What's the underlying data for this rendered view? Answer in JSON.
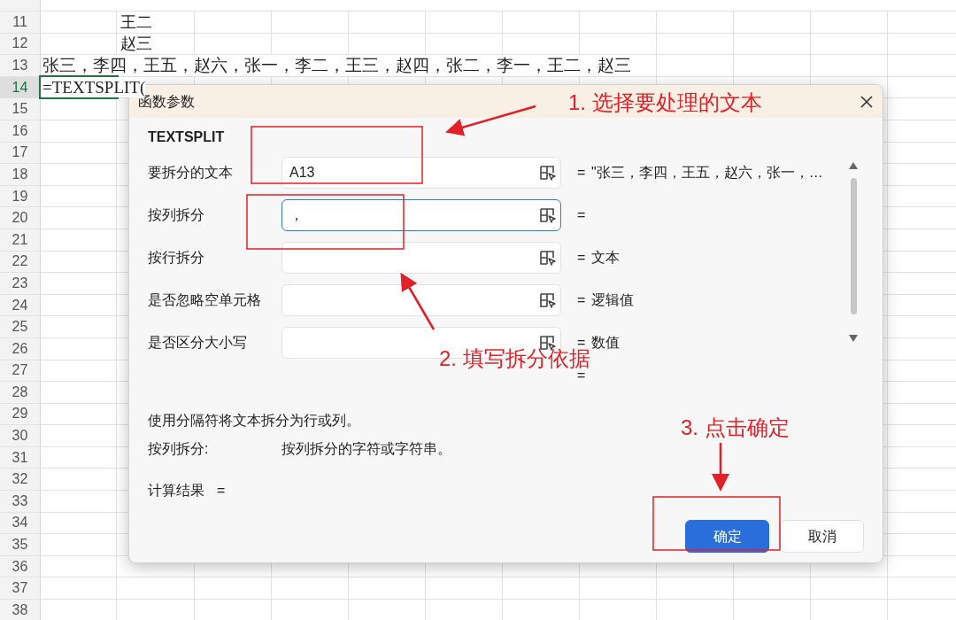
{
  "sheet": {
    "rows": [
      {
        "header": "11",
        "column_b": "王二",
        "selected": false
      },
      {
        "header": "12",
        "column_b": "赵三",
        "selected": false
      },
      {
        "header": "13",
        "column_a": "张三，李四，王五，赵六，张一，李二，王三，赵四，张二，李一，王二，赵三",
        "selected": false
      },
      {
        "header": "14",
        "column_a": "=TEXTSPLIT(",
        "selected": true
      },
      {
        "header": "15",
        "selected": false
      },
      {
        "header": "16",
        "selected": false
      },
      {
        "header": "17",
        "selected": false
      },
      {
        "header": "18",
        "selected": false
      },
      {
        "header": "19",
        "selected": false
      },
      {
        "header": "20",
        "selected": false
      },
      {
        "header": "21",
        "selected": false
      },
      {
        "header": "22",
        "selected": false
      },
      {
        "header": "23",
        "selected": false
      },
      {
        "header": "24",
        "selected": false
      },
      {
        "header": "25",
        "selected": false
      },
      {
        "header": "26",
        "selected": false
      },
      {
        "header": "27",
        "selected": false
      },
      {
        "header": "28",
        "selected": false
      },
      {
        "header": "29",
        "selected": false
      },
      {
        "header": "30",
        "selected": false
      },
      {
        "header": "31",
        "selected": false
      },
      {
        "header": "32",
        "selected": false
      },
      {
        "header": "33",
        "selected": false
      },
      {
        "header": "34",
        "selected": false
      },
      {
        "header": "35",
        "selected": false
      },
      {
        "header": "36",
        "selected": false
      },
      {
        "header": "37",
        "selected": false
      },
      {
        "header": "38",
        "selected": false
      }
    ]
  },
  "dialog": {
    "title": "函数参数",
    "function_name": "TEXTSPLIT",
    "arguments": [
      {
        "label": "要拆分的文本",
        "value": "A13",
        "focused": false,
        "equals": "=",
        "result": "\"张三，李四，王五，赵六，张一，…"
      },
      {
        "label": "按列拆分",
        "value": "，",
        "focused": true,
        "equals": "="
      },
      {
        "label": "按行拆分",
        "focused": false,
        "equals": "=",
        "result": "文本"
      },
      {
        "label": "是否忽略空单元格",
        "focused": false,
        "equals": "=",
        "result": "逻辑值"
      },
      {
        "label": "是否区分大小写",
        "focused": false,
        "equals": "=",
        "result": "数值"
      }
    ],
    "extra_equals": "=",
    "description": "使用分隔符将文本拆分为行或列。",
    "argument_help": {
      "name": "按列拆分:",
      "text": "按列拆分的字符或字符串。"
    },
    "result_label": "计算结果",
    "result_equals": "=",
    "buttons": [
      {
        "label": "确定",
        "kind": "primary"
      },
      {
        "label": "取消",
        "kind": "secondary"
      }
    ]
  },
  "annotations": [
    {
      "text": "1. 选择要处理的文本"
    },
    {
      "text": "2. 填写拆分依据"
    },
    {
      "text": "3. 点击确定"
    }
  ]
}
